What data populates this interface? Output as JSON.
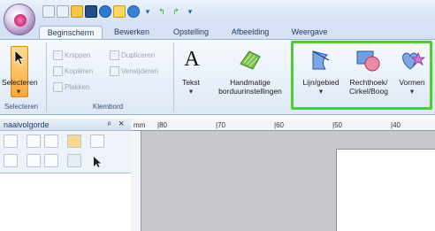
{
  "tabs": [
    "Beginscherm",
    "Bewerken",
    "Opstelling",
    "Afbeelding",
    "Weergave"
  ],
  "ribbon": {
    "select_label": "Selecteren",
    "select_group_label": "Selecteren",
    "clipboard": {
      "knippen": "Knippen",
      "dupliceren": "Dupliceren",
      "kopieren": "Kopiëren",
      "verwijderen": "Verwijderen",
      "plakken": "Plakken",
      "group_label": "Klembord"
    },
    "tekst_label": "Tekst",
    "handmatige_line1": "Handmatige",
    "handmatige_line2": "borduurinstellingen",
    "lijn_gebied": "Lijn/gebied",
    "rechthoek_line1": "Rechthoek/",
    "rechthoek_line2": "Cirkel/Boog",
    "vormen": "Vormen"
  },
  "panel": {
    "title": "naaivolgorde",
    "pin": "ᵖ",
    "close": "×"
  },
  "ruler": {
    "unit": "mm",
    "labels": [
      "|80",
      "|70",
      "|60",
      "|50",
      "|40"
    ]
  },
  "colors": {
    "highlight": "#47d12d",
    "select_active": "#f9a93a"
  },
  "icons": [
    "app-orb-icon",
    "new-icon",
    "open-icon",
    "save-icon",
    "undo-icon",
    "redo-icon",
    "cursor-icon",
    "text-icon",
    "stitch-settings-icon",
    "line-area-icon",
    "rect-circle-icon",
    "shapes-icon"
  ]
}
